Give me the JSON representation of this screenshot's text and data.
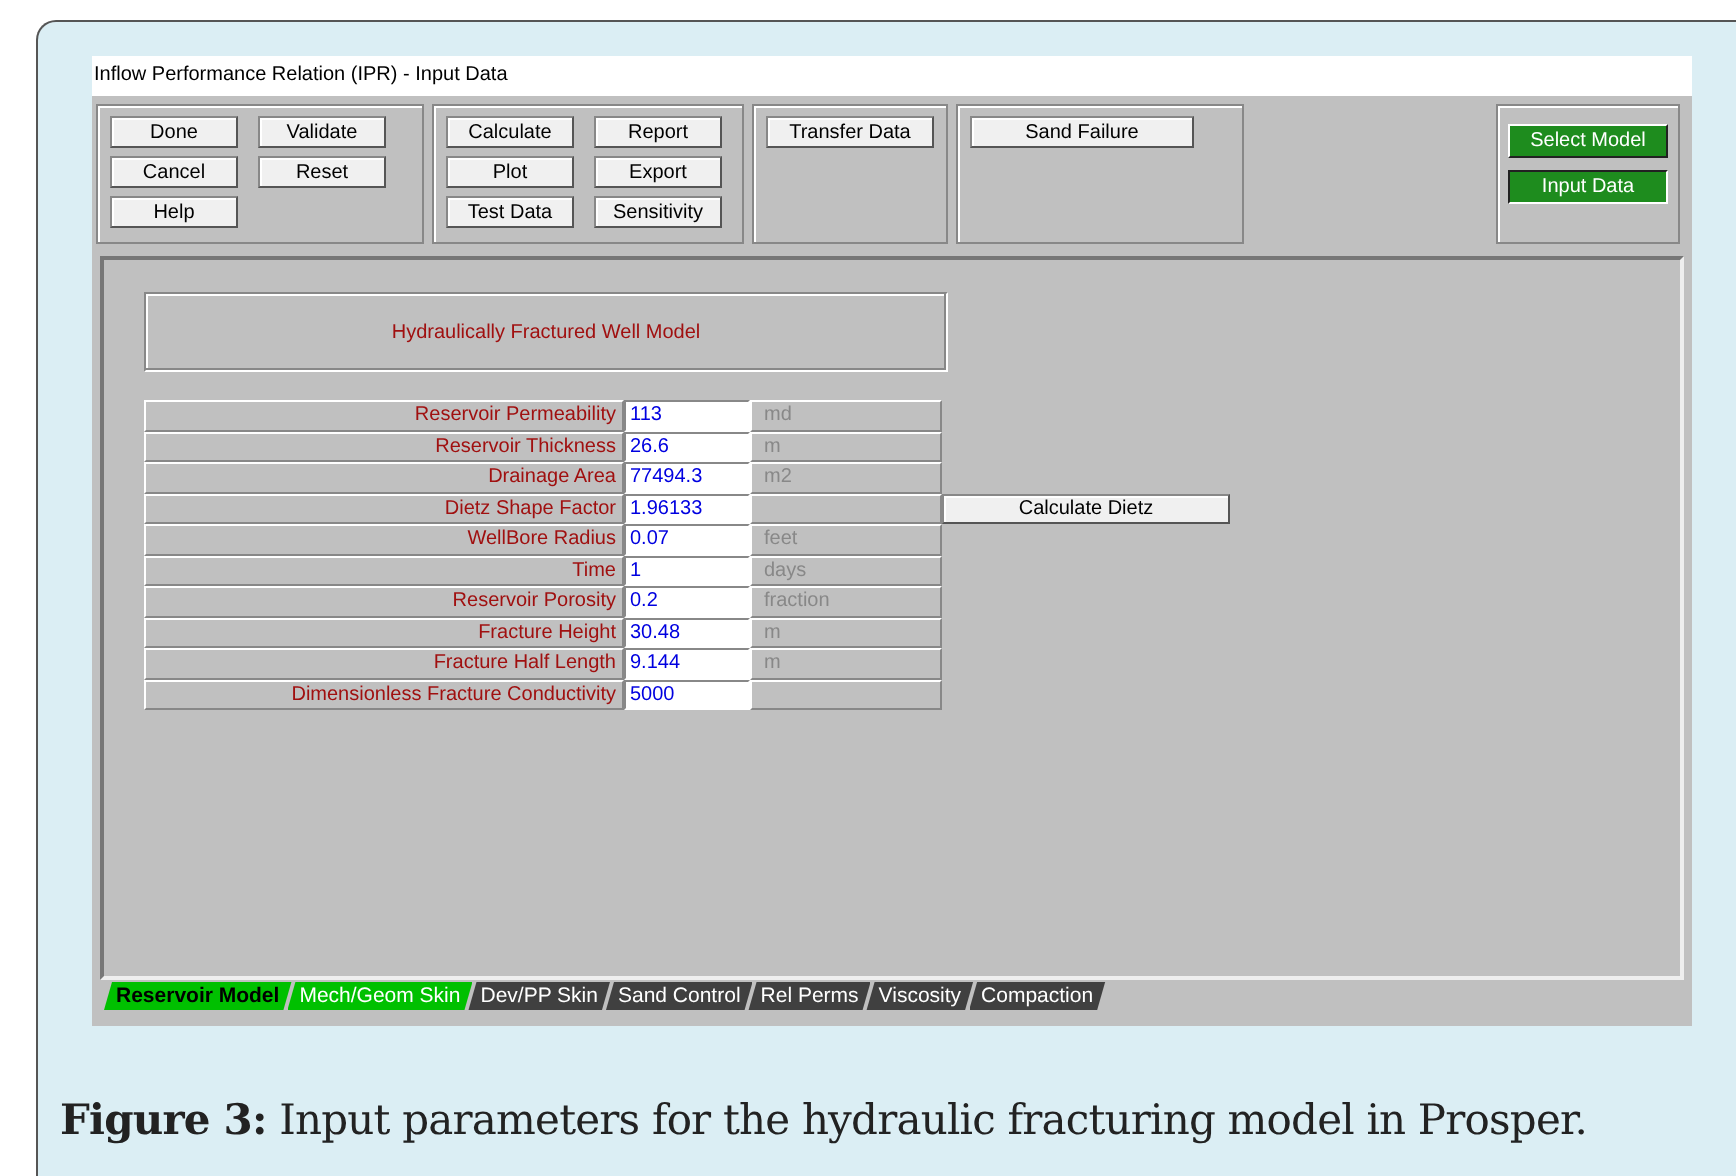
{
  "window": {
    "title": "Inflow Performance Relation (IPR) - Input Data"
  },
  "toolbar_groups": [
    {
      "buttons": [
        "Done",
        "Validate",
        "Cancel",
        "Reset",
        "Help"
      ]
    },
    {
      "buttons": [
        "Calculate",
        "Report",
        "Plot",
        "Export",
        "Test Data",
        "Sensitivity"
      ]
    },
    {
      "buttons": [
        "Transfer Data"
      ]
    },
    {
      "buttons": [
        "Sand Failure"
      ]
    }
  ],
  "model_buttons": [
    {
      "label": "Select Model",
      "selected": false
    },
    {
      "label": "Input Data",
      "selected": true
    }
  ],
  "model_title": "Hydraulically Fractured Well Model",
  "rows": [
    {
      "label": "Reservoir Permeability",
      "value": "113",
      "unit": "md"
    },
    {
      "label": "Reservoir Thickness",
      "value": "26.6",
      "unit": "m"
    },
    {
      "label": "Drainage Area",
      "value": "77494.3",
      "unit": "m2"
    },
    {
      "label": "Dietz Shape Factor",
      "value": "1.96133",
      "action": "Calculate Dietz"
    },
    {
      "label": "WellBore Radius",
      "value": "0.07",
      "unit": "feet"
    },
    {
      "label": "Time",
      "value": "1",
      "unit": "days"
    },
    {
      "label": "Reservoir Porosity",
      "value": "0.2",
      "unit": "fraction"
    },
    {
      "label": "Fracture Height",
      "value": "30.48",
      "unit": "m"
    },
    {
      "label": "Fracture Half Length",
      "value": "9.144",
      "unit": "m"
    },
    {
      "label": "Dimensionless Fracture Conductivity",
      "value": "5000"
    }
  ],
  "tabs": [
    {
      "label": "Reservoir Model",
      "selected": true,
      "color": "#00c000"
    },
    {
      "label": "Mech/Geom Skin",
      "selected": false,
      "color": "#00c000"
    },
    {
      "label": "Dev/PP Skin",
      "selected": false,
      "color": "#404040"
    },
    {
      "label": "Sand Control",
      "selected": false,
      "color": "#404040"
    },
    {
      "label": "Rel Perms",
      "selected": false,
      "color": "#404040"
    },
    {
      "label": "Viscosity",
      "selected": false,
      "color": "#404040"
    },
    {
      "label": "Compaction",
      "selected": false,
      "color": "#404040"
    }
  ],
  "caption": "**Figure 3:** Input parameters for the hydraulic fracturing model in Prosper."
}
